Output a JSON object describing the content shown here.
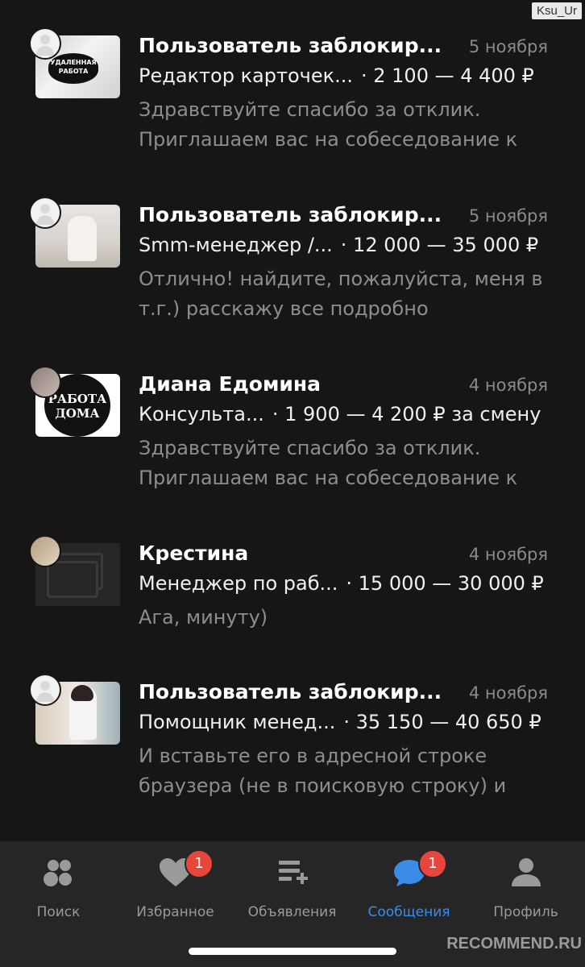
{
  "watermark_top": "Ksu_Ur",
  "chats": [
    {
      "title": "Пользователь заблокир...",
      "date": "5 ноября",
      "job": "Редактор карточек...",
      "salary": "· 2 100 — 4 400 ₽",
      "preview": "Здравствуйте спасибо за отклик. Приглашаем вас на собеседование к",
      "thumb_text": "УДАЛЕННАЯ РАБОТА"
    },
    {
      "title": "Пользователь заблокир...",
      "date": "5 ноября",
      "job": "Smm-менеджер /...",
      "salary": "· 12 000 — 35 000 ₽",
      "preview": "Отлично! найдите, пожалуйста, меня в т.г.) расскажу все подробно"
    },
    {
      "title": "Диана Едомина",
      "date": "4 ноября",
      "job": "Консульта...",
      "salary": "· 1 900 — 4 200 ₽ за смену",
      "preview": "Здравствуйте спасибо за отклик. Приглашаем вас на собеседование к",
      "thumb_text": "РАБОТА ДОМА"
    },
    {
      "title": "Крестина",
      "date": "4 ноября",
      "job": "Менеджер по раб...",
      "salary": "· 15 000 — 30 000 ₽",
      "preview": "Ага, минуту)"
    },
    {
      "title": "Пользователь заблокир...",
      "date": "4 ноября",
      "job": "Помощник менед...",
      "salary": "· 35 150 — 40 650 ₽",
      "preview": "И вставьте его в адресной строке браузера (не в поисковую строку) и"
    }
  ],
  "tabs": [
    {
      "label": "Поиск",
      "icon": "search-dots-icon"
    },
    {
      "label": "Избранное",
      "icon": "heart-icon",
      "badge": "1"
    },
    {
      "label": "Объявления",
      "icon": "list-add-icon"
    },
    {
      "label": "Сообщения",
      "icon": "chat-bubble-icon",
      "badge": "1",
      "active": true
    },
    {
      "label": "Профиль",
      "icon": "profile-icon"
    }
  ],
  "colors": {
    "background": "#161616",
    "tabbar": "#262626",
    "accent": "#3a8ce6",
    "badge": "#e8453c"
  },
  "watermark_bottom": "RECOMMEND.RU"
}
